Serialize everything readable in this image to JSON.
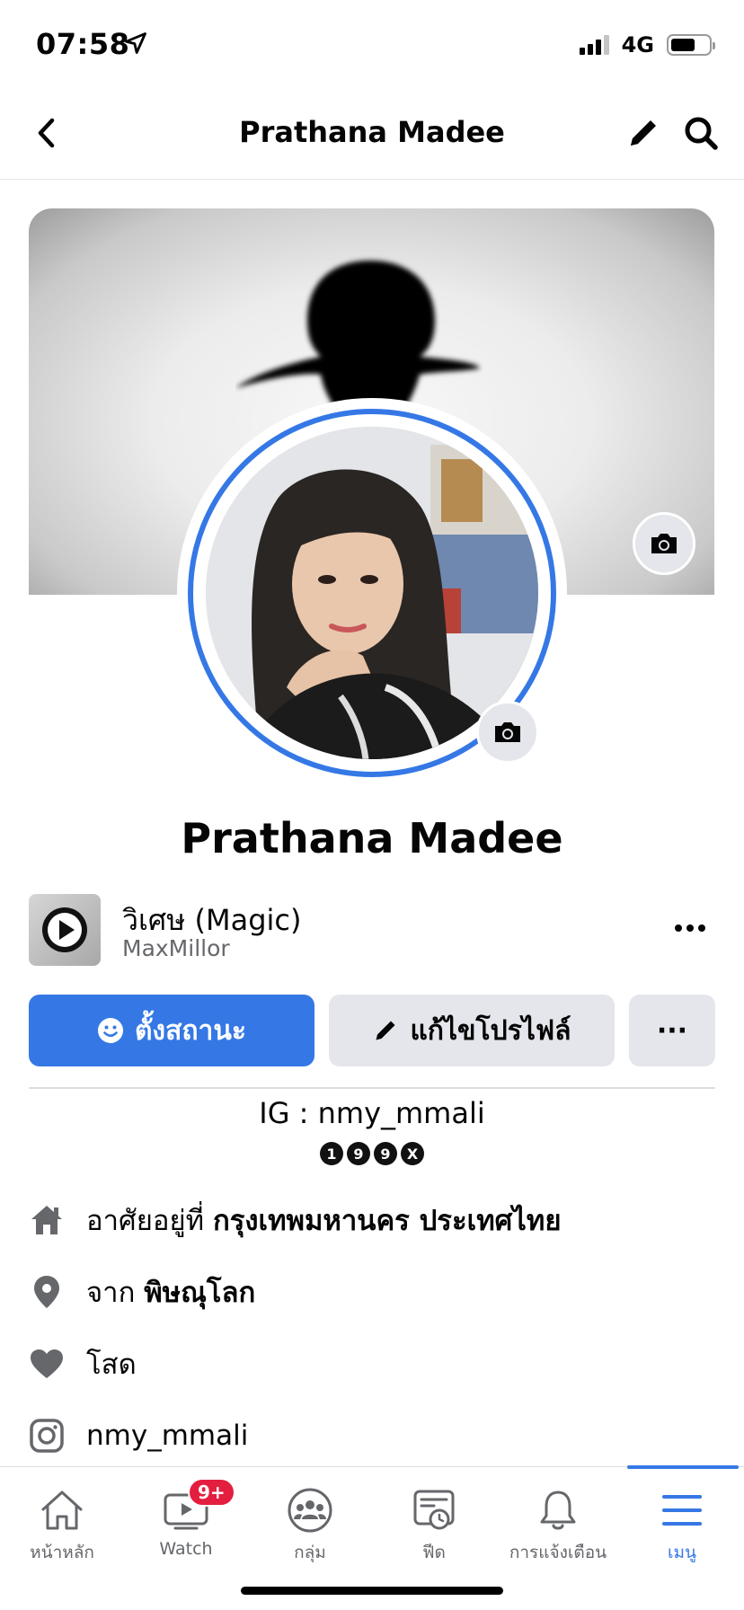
{
  "status_bar": {
    "time": "07:58",
    "network": "4G"
  },
  "header": {
    "title": "Prathana Madee"
  },
  "profile": {
    "name": "Prathana Madee",
    "music": {
      "title": "วิเศษ (Magic)",
      "artist": "MaxMillor"
    },
    "actions": {
      "status_label": "ตั้งสถานะ",
      "edit_label": "แก้ไขโปรไฟล์",
      "more_label": "···"
    },
    "bio": "IG : nmy_mmali",
    "bio_badges": [
      "1",
      "9",
      "9",
      "X"
    ],
    "details": {
      "lives_prefix": "อาศัยอยู่ที่",
      "lives_place": "กรุงเทพมหานคร ประเทศไทย",
      "from_prefix": "จาก",
      "from_place": "พิษณุโลก",
      "relationship": "โสด",
      "instagram": "nmy_mmali"
    }
  },
  "tabbar": {
    "items": [
      {
        "label": "หน้าหลัก",
        "icon": "home-icon"
      },
      {
        "label": "Watch",
        "icon": "watch-icon",
        "badge": "9+"
      },
      {
        "label": "กลุ่ม",
        "icon": "groups-icon"
      },
      {
        "label": "ฟีด",
        "icon": "feed-icon"
      },
      {
        "label": "การแจ้งเตือน",
        "icon": "bell-icon"
      },
      {
        "label": "เมนู",
        "icon": "menu-icon"
      }
    ],
    "active_index": 5
  },
  "colors": {
    "accent": "#3578e5",
    "badge": "#e41e3f",
    "secondary_text": "#65676b",
    "button_gray": "#e4e6eb"
  }
}
